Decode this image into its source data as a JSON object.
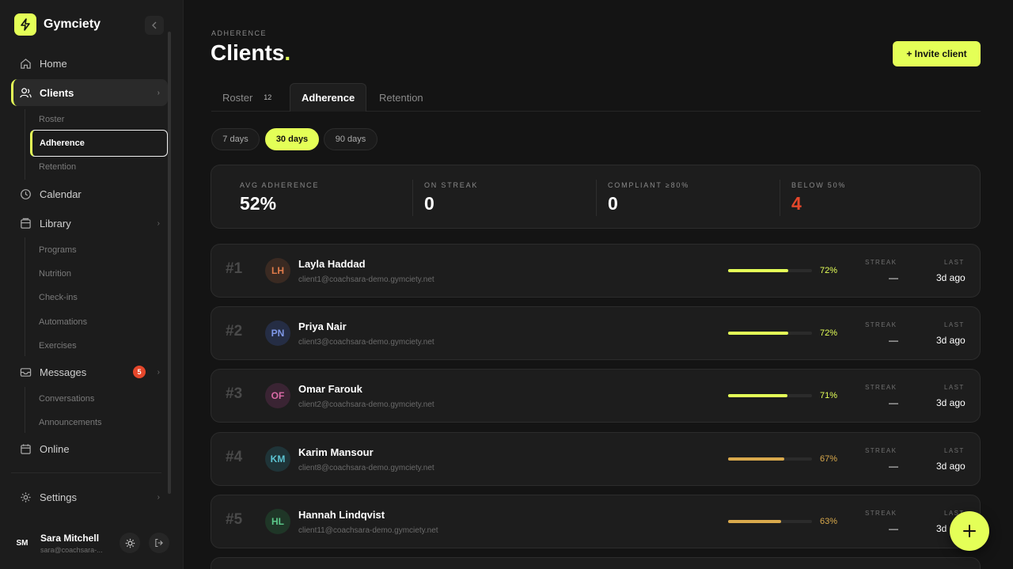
{
  "app": {
    "name": "Gymciety",
    "accent": "#e4ff57"
  },
  "sidebar": {
    "nav": [
      {
        "id": "home",
        "label": "Home",
        "icon": "home-icon"
      },
      {
        "id": "clients",
        "label": "Clients",
        "icon": "users-icon",
        "active": true
      },
      {
        "id": "calendar",
        "label": "Calendar",
        "icon": "clock-icon"
      },
      {
        "id": "library",
        "label": "Library",
        "icon": "library-icon"
      },
      {
        "id": "messages",
        "label": "Messages",
        "icon": "inbox-icon",
        "badge": "5"
      },
      {
        "id": "online",
        "label": "Online",
        "icon": "calendar-icon"
      },
      {
        "id": "settings",
        "label": "Settings",
        "icon": "gear-icon"
      }
    ],
    "clients_sub": [
      "Roster",
      "Adherence",
      "Retention"
    ],
    "library_sub": [
      "Programs",
      "Nutrition",
      "Check-ins",
      "Automations",
      "Exercises"
    ],
    "messages_sub": [
      "Conversations",
      "Announcements"
    ],
    "user": {
      "initials": "SM",
      "name": "Sara Mitchell",
      "email": "sara@coachsara-..."
    }
  },
  "header": {
    "eyebrow": "ADHERENCE",
    "title": "Clients",
    "title_dot": ".",
    "invite_label": "+ Invite client"
  },
  "tabs": [
    {
      "label": "Roster",
      "count": "12"
    },
    {
      "label": "Adherence",
      "active": true
    },
    {
      "label": "Retention"
    }
  ],
  "ranges": [
    {
      "label": "7 days"
    },
    {
      "label": "30 days",
      "active": true
    },
    {
      "label": "90 days"
    }
  ],
  "stats": [
    {
      "label": "AVG ADHERENCE",
      "value": "52%",
      "color": "#ffffff"
    },
    {
      "label": "ON STREAK",
      "value": "0",
      "color": "#ffffff"
    },
    {
      "label": "COMPLIANT ≥80%",
      "value": "0",
      "color": "#ffffff"
    },
    {
      "label": "BELOW 50%",
      "value": "4",
      "color": "#e5472b"
    }
  ],
  "row_labels": {
    "streak": "STREAK",
    "last": "LAST"
  },
  "clients": [
    {
      "rank": "#1",
      "initials": "LH",
      "name": "Layla Haddad",
      "email": "client1@coachsara-demo.gymciety.net",
      "adherence": 72,
      "pct_label": "72%",
      "streak": "—",
      "last": "3d ago",
      "bar_color": "#e4ff57",
      "avatar_bg": "#3a2a22",
      "avatar_fg": "#e07b4a"
    },
    {
      "rank": "#2",
      "initials": "PN",
      "name": "Priya Nair",
      "email": "client3@coachsara-demo.gymciety.net",
      "adherence": 72,
      "pct_label": "72%",
      "streak": "—",
      "last": "3d ago",
      "bar_color": "#e4ff57",
      "avatar_bg": "#252d44",
      "avatar_fg": "#7f98e8"
    },
    {
      "rank": "#3",
      "initials": "OF",
      "name": "Omar Farouk",
      "email": "client2@coachsara-demo.gymciety.net",
      "adherence": 71,
      "pct_label": "71%",
      "streak": "—",
      "last": "3d ago",
      "bar_color": "#e4ff57",
      "avatar_bg": "#3a2433",
      "avatar_fg": "#d86aa6"
    },
    {
      "rank": "#4",
      "initials": "KM",
      "name": "Karim Mansour",
      "email": "client8@coachsara-demo.gymciety.net",
      "adherence": 67,
      "pct_label": "67%",
      "streak": "—",
      "last": "3d ago",
      "bar_color": "#d9a94c",
      "avatar_bg": "#1f3438",
      "avatar_fg": "#5cc3d2"
    },
    {
      "rank": "#5",
      "initials": "HL",
      "name": "Hannah Lindqvist",
      "email": "client11@coachsara-demo.gymciety.net",
      "adherence": 63,
      "pct_label": "63%",
      "streak": "—",
      "last": "3d ago",
      "bar_color": "#d9a94c",
      "avatar_bg": "#1f3627",
      "avatar_fg": "#5cc98a"
    }
  ],
  "fab": {
    "icon": "plus-icon"
  }
}
